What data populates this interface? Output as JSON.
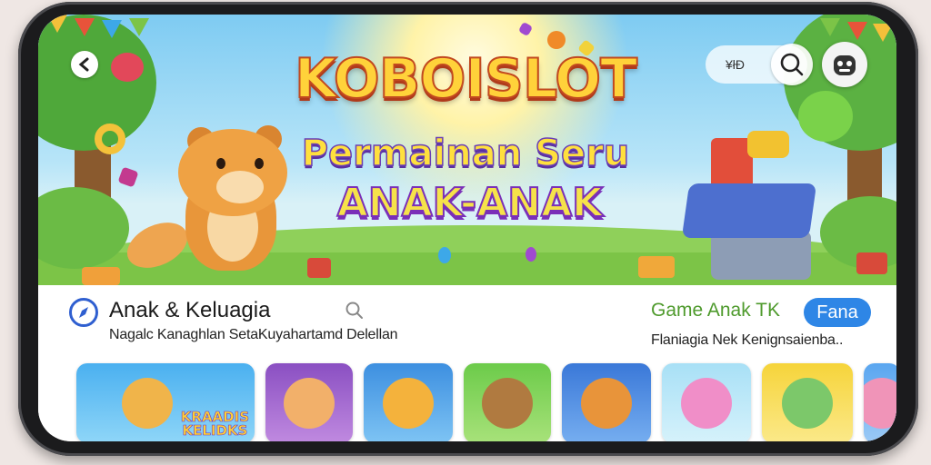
{
  "banner": {
    "title": "KOBOISLOT",
    "subtitle": "Permainan Seru",
    "subtitle2": "ANAK-ANAK",
    "pill_text": "¥łĐ",
    "back_icon": "arrow-left-icon",
    "search_icon": "search-icon",
    "avatar_icon": "robot-face-icon"
  },
  "category": {
    "icon": "compass-icon",
    "title": "Anak & Keluagia",
    "subtitle": "Nagalc Kanaghlan SetaKuyahartamd Delellan"
  },
  "featured": {
    "title": "Game Anak TK",
    "badge": "Fana",
    "subtitle": "Flaniagia Nek Kenignsaienba.."
  },
  "cards": [
    {
      "id": "card-1",
      "label_top": "KRAADIS",
      "label_bottom": "KELIDKS",
      "colors": [
        "#4ab0f0",
        "#f0b44a"
      ]
    },
    {
      "id": "card-2",
      "colors": [
        "#8a4fc2",
        "#f2b06a"
      ]
    },
    {
      "id": "card-3",
      "colors": [
        "#3d8fe0",
        "#f4b23c"
      ]
    },
    {
      "id": "card-4",
      "colors": [
        "#6ccb4a",
        "#b07a40"
      ]
    },
    {
      "id": "card-5",
      "colors": [
        "#3a78d8",
        "#e8943a"
      ]
    },
    {
      "id": "card-6",
      "colors": [
        "#a8e0f6",
        "#f08ec8"
      ]
    },
    {
      "id": "card-7",
      "colors": [
        "#f6d43a",
        "#7cc86a"
      ]
    },
    {
      "id": "card-8",
      "colors": [
        "#5aa6f0",
        "#f094b8"
      ]
    }
  ],
  "colors": {
    "accent_blue": "#2e86e6",
    "featured_green": "#4e9a2c"
  }
}
